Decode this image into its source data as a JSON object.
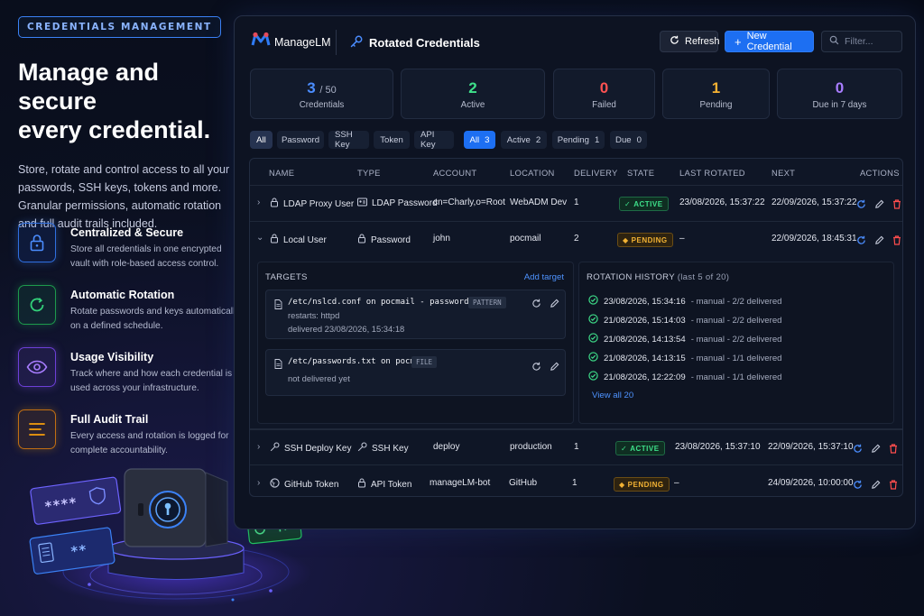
{
  "hero": {
    "pill": "CREDENTIALS MANAGEMENT",
    "headline_line1": "Manage and secure",
    "headline_line2": "every credential.",
    "intro": "Store, rotate and control access to all your passwords, SSH keys, tokens and more. Granular permissions, automatic rotation and full audit trails included."
  },
  "features": [
    {
      "title": "Centralized & Secure",
      "desc": "Store all credentials in one encrypted vault with role-based access control.",
      "icon": "lock-icon",
      "color": "#3b82f6"
    },
    {
      "title": "Automatic Rotation",
      "desc": "Rotate passwords and keys automatically on a defined schedule.",
      "icon": "rotate-icon",
      "color": "#22c55e"
    },
    {
      "title": "Usage Visibility",
      "desc": "Track where and how each credential is used across your infrastructure.",
      "icon": "eye-icon",
      "color": "#8b5cf6"
    },
    {
      "title": "Full Audit Trail",
      "desc": "Every access and rotation is logged for complete accountability.",
      "icon": "list-icon",
      "color": "#f59e0b"
    }
  ],
  "app": {
    "logo": "ManageLM",
    "title": "Rotated Credentials",
    "refresh_label": "Refresh",
    "new_label": "New Credential",
    "filter_placeholder": "Filter..."
  },
  "stats": [
    {
      "value": "3",
      "suffix": "/ 50",
      "label": "Credentials",
      "color": "#4b8dff"
    },
    {
      "value": "2",
      "suffix": "",
      "label": "Active",
      "color": "#3ee08a"
    },
    {
      "value": "0",
      "suffix": "",
      "label": "Failed",
      "color": "#ff5252"
    },
    {
      "value": "1",
      "suffix": "",
      "label": "Pending",
      "color": "#f5b133"
    },
    {
      "value": "0",
      "suffix": "",
      "label": "Due in 7 days",
      "color": "#a87dff"
    }
  ],
  "type_filters": [
    "All",
    "Password",
    "SSH Key",
    "Token",
    "API Key"
  ],
  "state_filters": [
    {
      "label": "All",
      "count": "3"
    },
    {
      "label": "Active",
      "count": "2"
    },
    {
      "label": "Pending",
      "count": "1"
    },
    {
      "label": "Due",
      "count": "0"
    }
  ],
  "columns": [
    "NAME",
    "TYPE",
    "ACCOUNT",
    "LOCATION",
    "DELIVERY",
    "STATE",
    "LAST ROTATED",
    "NEXT",
    "ACTIONS"
  ],
  "rows": [
    {
      "chevron": "›",
      "name": "LDAP Proxy User",
      "type": "LDAP Password",
      "account": "cn=Charly,o=Root",
      "location": "WebADM Dev",
      "delivery": "1",
      "state": "ACTIVE",
      "last": "23/08/2026, 15:37:22",
      "next": "22/09/2026, 15:37:22"
    },
    {
      "chevron": "⌄",
      "name": "Local User",
      "type": "Password",
      "account": "john",
      "location": "pocmail",
      "delivery": "2",
      "state": "PENDING",
      "last": "–",
      "next": "22/09/2026, 18:45:31"
    },
    {
      "chevron": "›",
      "name": "SSH Deploy Key",
      "type": "SSH Key",
      "account": "deploy",
      "location": "production",
      "delivery": "1",
      "state": "ACTIVE",
      "last": "23/08/2026, 15:37:10",
      "next": "22/09/2026, 15:37:10"
    },
    {
      "chevron": "›",
      "name": "GitHub Token",
      "type": "API Token",
      "account": "manageLM-bot",
      "location": "GitHub",
      "delivery": "1",
      "state": "PENDING",
      "last": "–",
      "next": "24/09/2026, 10:00:00"
    }
  ],
  "targets": {
    "title": "TARGETS",
    "add_label": "Add target",
    "items": [
      {
        "path": "/etc/nslcd.conf on pocmail - password \".+}\"",
        "tag": "PATTERN",
        "line1": "restarts: httpd",
        "line2": "delivered 23/08/2026, 15:34:18"
      },
      {
        "path": "/etc/passwords.txt on pocmail",
        "tag": "FILE",
        "line1": "not delivered yet",
        "line2": ""
      }
    ]
  },
  "history": {
    "title": "ROTATION HISTORY",
    "subtitle": "(last 5 of 20)",
    "items": [
      {
        "time": "23/08/2026, 15:34:16",
        "meta": "- manual - 2/2 delivered"
      },
      {
        "time": "21/08/2026, 15:14:03",
        "meta": "- manual - 2/2 delivered"
      },
      {
        "time": "21/08/2026, 14:13:54",
        "meta": "- manual - 2/2 delivered"
      },
      {
        "time": "21/08/2026, 14:13:15",
        "meta": "- manual - 1/1 delivered"
      },
      {
        "time": "21/08/2026, 12:22:09",
        "meta": "- manual - 1/1 delivered"
      }
    ],
    "view_all": "View all 20"
  },
  "art": {
    "password_mask": "****",
    "key_mask": "**"
  }
}
